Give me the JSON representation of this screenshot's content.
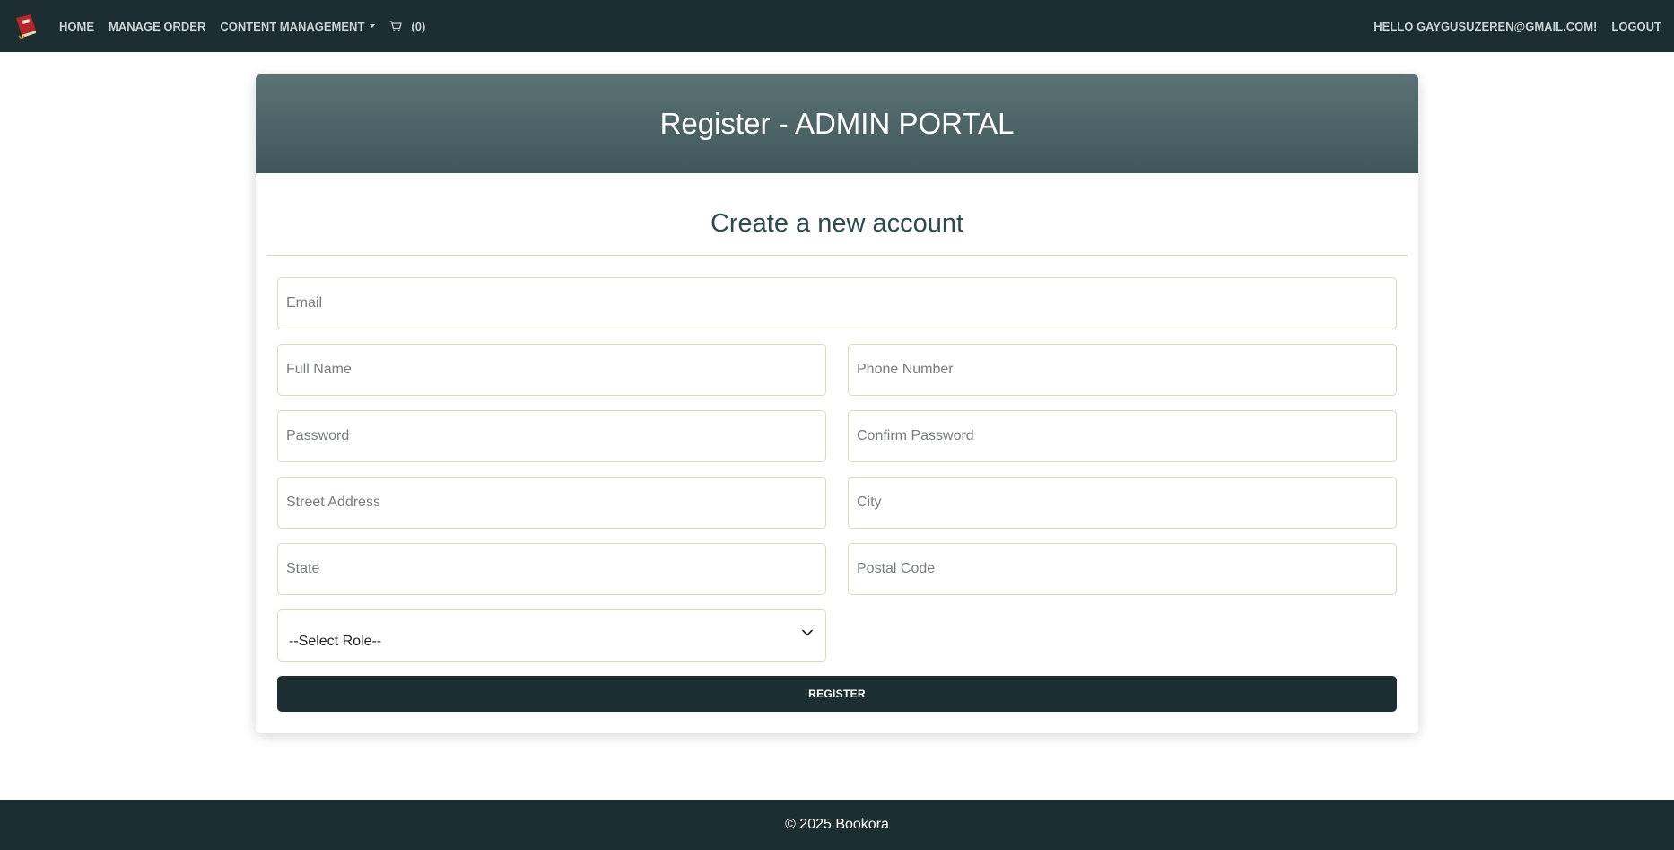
{
  "navbar": {
    "logo_icon": "book-logo-icon",
    "items": [
      {
        "label": "HOME"
      },
      {
        "label": "MANAGE ORDER"
      },
      {
        "label": "CONTENT MANAGEMENT"
      }
    ],
    "cart_icon": "cart-icon",
    "cart_count": "(0)",
    "greeting": "HELLO GAYGUSUZEREN@GMAIL.COM!",
    "logout": "LOGOUT"
  },
  "card": {
    "header_title": "Register - ADMIN PORTAL",
    "subtitle": "Create a new account"
  },
  "form": {
    "email": {
      "placeholder": "Email",
      "value": ""
    },
    "full_name": {
      "placeholder": "Full Name",
      "value": ""
    },
    "phone": {
      "placeholder": "Phone Number",
      "value": ""
    },
    "password": {
      "placeholder": "Password",
      "value": ""
    },
    "confirm_password": {
      "placeholder": "Confirm Password",
      "value": ""
    },
    "street": {
      "placeholder": "Street Address",
      "value": ""
    },
    "city": {
      "placeholder": "City",
      "value": ""
    },
    "state": {
      "placeholder": "State",
      "value": ""
    },
    "postal": {
      "placeholder": "Postal Code",
      "value": ""
    },
    "role": {
      "selected": "--Select Role--"
    },
    "submit_label": "REGISTER"
  },
  "footer": {
    "text": "© 2025 Bookora"
  },
  "colors": {
    "nav_bg": "#1c2e31",
    "header_gradient_top": "#5c7376",
    "header_gradient_bottom": "#3f575a",
    "button_bg": "#1c2e31"
  }
}
